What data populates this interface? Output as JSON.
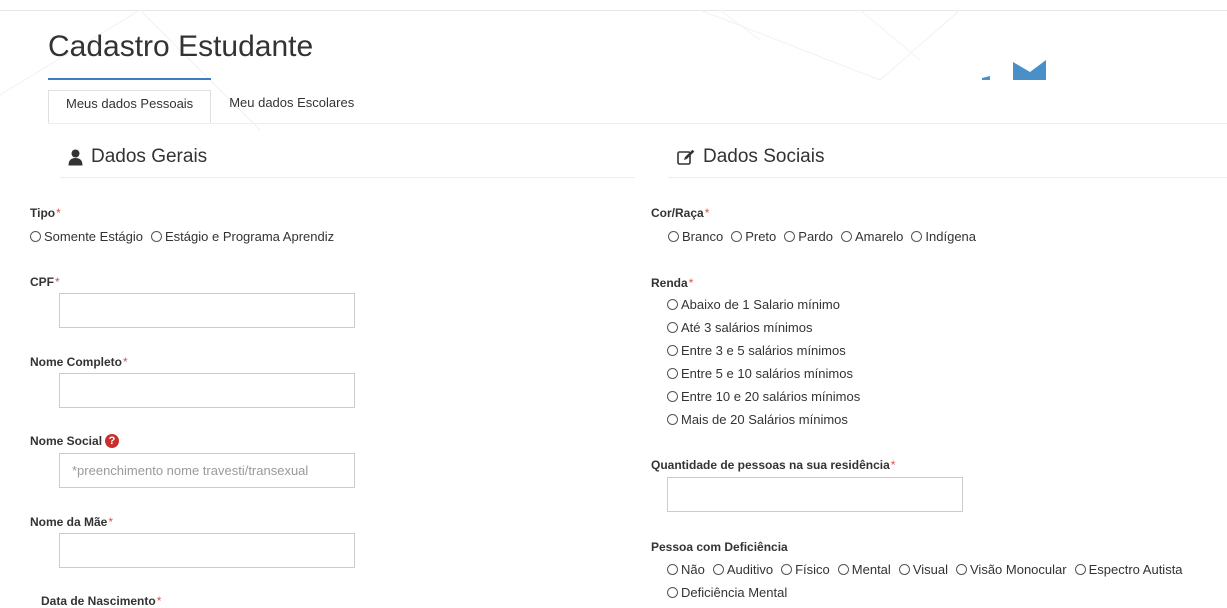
{
  "page": {
    "title": "Cadastro Estudante",
    "tabs": [
      {
        "label": "Meus dados Pessoais",
        "active": true
      },
      {
        "label": "Meu dados Escolares",
        "active": false
      }
    ]
  },
  "colors": {
    "accent": "#3b7dc4",
    "required": "#d9534f",
    "help": "#c9302c",
    "logo": "#4a90c8"
  },
  "left": {
    "heading": "Dados Gerais",
    "heading_icon": "user-icon",
    "tipo": {
      "label": "Tipo",
      "required": "*",
      "options": [
        "Somente Estágio",
        "Estágio e Programa Aprendiz"
      ]
    },
    "cpf": {
      "label": "CPF",
      "required": "*",
      "value": "",
      "placeholder": ""
    },
    "nome_completo": {
      "label": "Nome Completo",
      "required": "*",
      "value": "",
      "placeholder": ""
    },
    "nome_social": {
      "label": "Nome Social",
      "help_icon": "question-circle-icon",
      "help_glyph": "?",
      "value": "",
      "placeholder": "*preenchimento nome travesti/transexual"
    },
    "nome_mae": {
      "label": "Nome da Mãe",
      "required": "*",
      "value": "",
      "placeholder": ""
    },
    "data_nascimento": {
      "label": "Data de Nascimento",
      "required": "*"
    }
  },
  "right": {
    "heading": "Dados Sociais",
    "heading_icon": "edit-icon",
    "cor_raca": {
      "label": "Cor/Raça",
      "required": "*",
      "options": [
        "Branco",
        "Preto",
        "Pardo",
        "Amarelo",
        "Indígena"
      ]
    },
    "renda": {
      "label": "Renda",
      "required": "*",
      "options": [
        "Abaixo de 1 Salario mínimo",
        "Até 3 salários mínimos",
        "Entre 3 e 5 salários mínimos",
        "Entre 5 e 10 salários mínimos",
        "Entre 10 e 20 salários mínimos",
        "Mais de 20 Salários mínimos"
      ]
    },
    "qtd_pessoas": {
      "label": "Quantidade de pessoas na sua residência",
      "required": "*",
      "value": ""
    },
    "deficiencia": {
      "label": "Pessoa com Deficiência",
      "options": [
        "Não",
        "Auditivo",
        "Físico",
        "Mental",
        "Visual",
        "Visão Monocular",
        "Espectro Autista",
        "Deficiência Mental"
      ]
    }
  }
}
